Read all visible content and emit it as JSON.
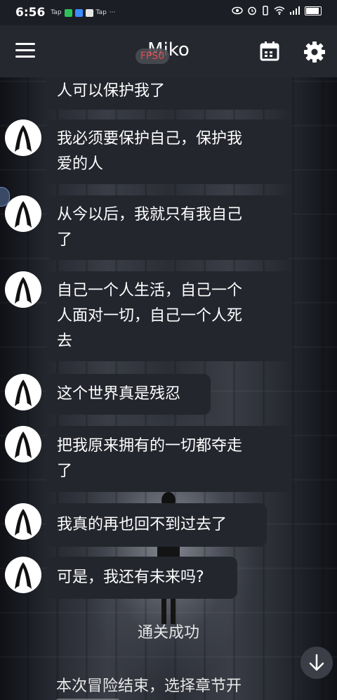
{
  "status_bar": {
    "time": "6:56",
    "app1": "Tap",
    "app2": "Tap",
    "more": "···"
  },
  "header": {
    "title": "Miko",
    "fps_label": "FPS0",
    "menu_icon": "hamburger-menu-icon",
    "calendar_icon": "calendar-icon",
    "settings_icon": "gear-icon"
  },
  "messages": [
    {
      "text_lines": [
        "人可以保护我了"
      ]
    },
    {
      "text_lines": [
        "我必须要保护自己，保护我",
        "爱的人"
      ]
    },
    {
      "text_lines": [
        "从今以后，我就只有我自己",
        "了"
      ]
    },
    {
      "text_lines": [
        "自己一个人生活，自己一个",
        "人面对一切，自己一个人死",
        "去"
      ]
    },
    {
      "text_lines": [
        "这个世界真是残忍"
      ]
    },
    {
      "text_lines": [
        "把我原来拥有的一切都夺走",
        "了"
      ]
    },
    {
      "text_lines": [
        "我真的再也回不到过去了"
      ]
    },
    {
      "text_lines": [
        "可是，我还有未来吗?"
      ]
    }
  ],
  "system": {
    "success": "通关成功",
    "ending": "本次冒险结束，选择章节开"
  },
  "colors": {
    "bubble": "#24262e",
    "header": "#262830",
    "fps_text": "#ff4d4d"
  },
  "scroll_icon": "arrow-down-icon"
}
